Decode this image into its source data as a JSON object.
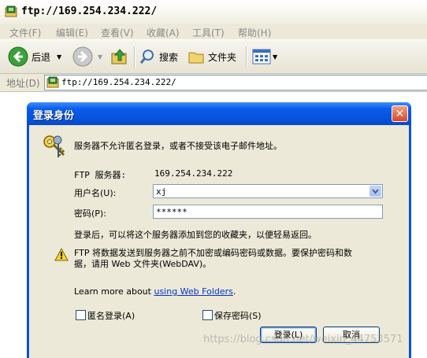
{
  "window": {
    "title": "ftp://169.254.234.222/"
  },
  "menu": [
    "文件(F)",
    "编辑(E)",
    "查看(V)",
    "收藏(A)",
    "工具(T)",
    "帮助(H)"
  ],
  "toolbar": {
    "back": "后退",
    "search": "搜索",
    "folders": "文件夹"
  },
  "address": {
    "label": "地址(D)",
    "value": "ftp://169.254.234.222/"
  },
  "dialog": {
    "title": "登录身份",
    "message": "服务器不允许匿名登录，或者不接受该电子邮件地址。",
    "ftp_server_label": "FTP 服务器:",
    "ftp_server_value": "169.254.234.222",
    "username_label": "用户名(U):",
    "username_value": "xj",
    "password_label": "密码(P):",
    "password_value": "******",
    "info": "登录后，可以将这个服务器添加到您的收藏夹，以便轻易返回。",
    "warning_line1": "FTP 将数据发送到服务器之前不加密或编码密码或数据。要保护密码和数",
    "warning_line2": "据，请用 Web 文件夹(WebDAV)。",
    "learn_more_prefix": "Learn more about ",
    "learn_more_link": "using Web Folders",
    "learn_more_suffix": ".",
    "anonymous_label": "匿名登录(A)",
    "save_password_label": "保存密码(S)",
    "login_button": "登录(L)",
    "cancel_button": "取消"
  },
  "watermark": "https://blog.csdn.net/weixin_44753571"
}
